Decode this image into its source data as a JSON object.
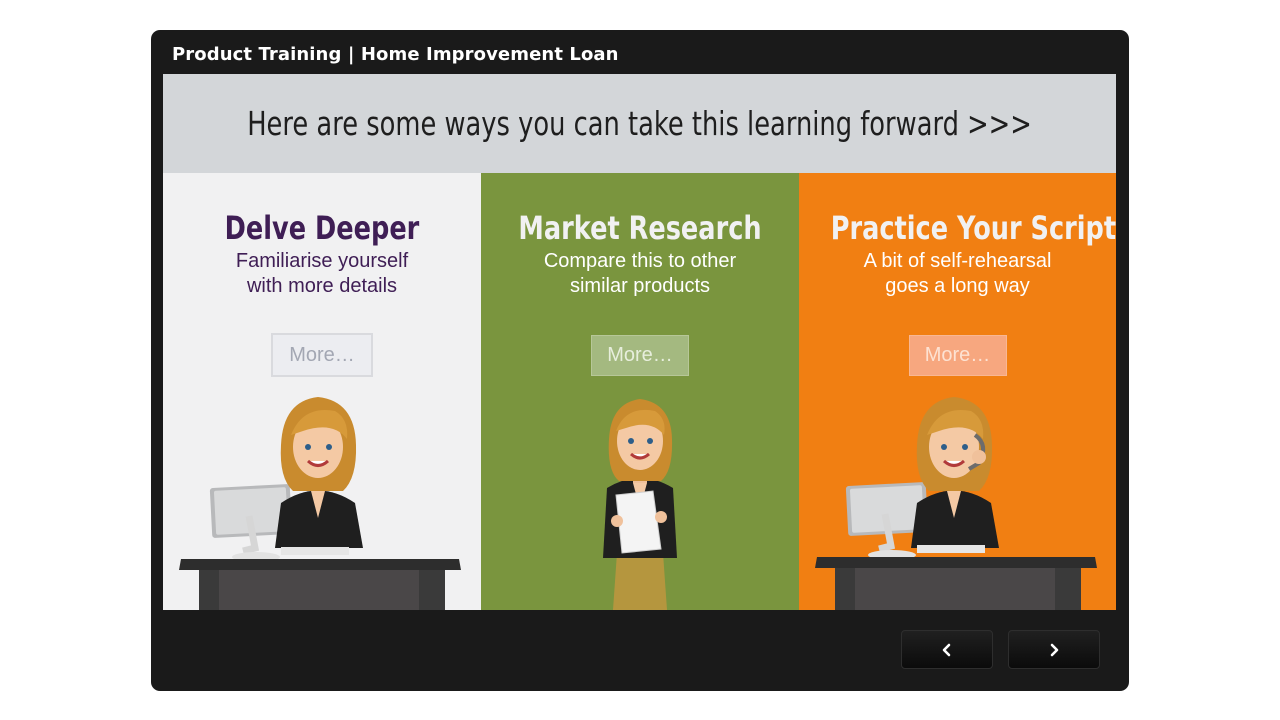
{
  "player": {
    "title": "Product Training | Home Improvement Loan"
  },
  "slide": {
    "heading": "Here are some ways you can take this learning forward >>>",
    "columns": [
      {
        "title": "Delve Deeper",
        "subtitle_line1": "Familiarise yourself",
        "subtitle_line2": "with more details",
        "button": "More…",
        "illustration": "woman-at-computer-desk"
      },
      {
        "title": "Market Research",
        "subtitle_line1": "Compare this to other",
        "subtitle_line2": "similar products",
        "button": "More…",
        "illustration": "woman-holding-paper"
      },
      {
        "title": "Practice Your Script",
        "subtitle_line1": "A bit of self-rehearsal",
        "subtitle_line2": "goes a long way",
        "button": "More…",
        "illustration": "woman-with-headset-at-desk"
      }
    ]
  },
  "navigation": {
    "prev_icon": "chevron-left-icon",
    "next_icon": "chevron-right-icon"
  },
  "colors": {
    "frame": "#1a1a1a",
    "header_band": "#d3d6d9",
    "column_1": "#f1f1f2",
    "column_2": "#7a953e",
    "column_3": "#f17f12",
    "title_purple": "#3f1e55"
  }
}
